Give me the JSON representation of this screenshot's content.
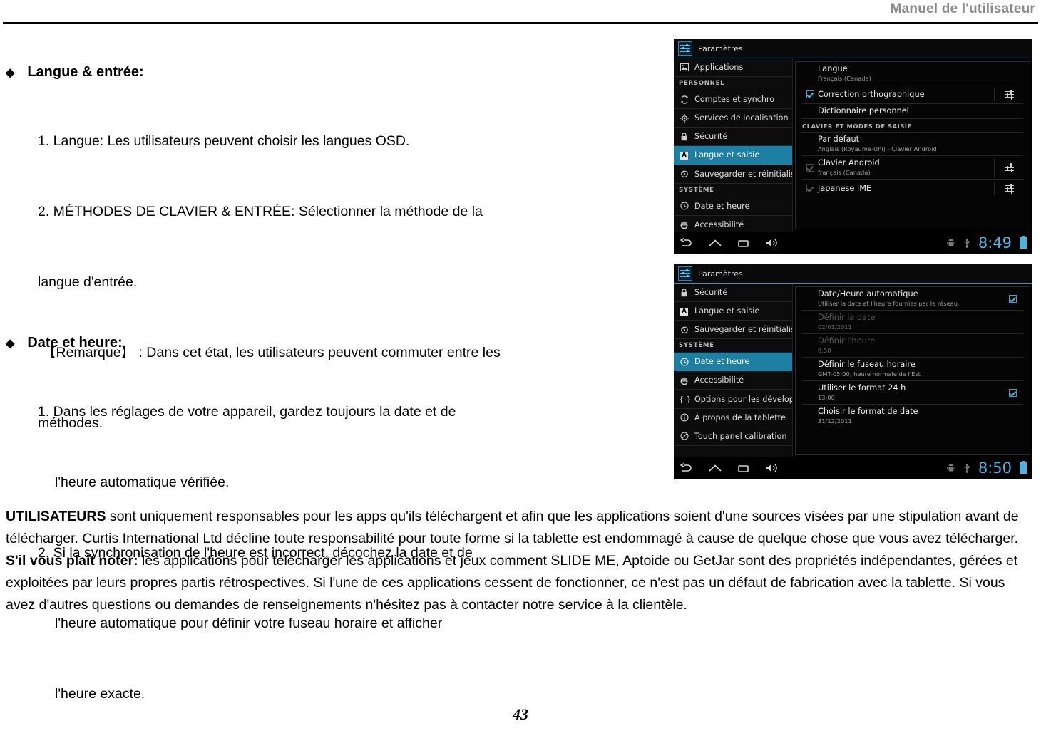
{
  "header": {
    "title": "Manuel de l'utilisateur"
  },
  "page_number": "43",
  "sections": [
    {
      "bullet": "◆",
      "heading": "Langue  & entrée:",
      "lines": [
        "1. Langue: Les utilisateurs peuvent choisir les langues OSD.",
        "2. MÉTHODES DE CLAVIER & ENTRÉE: Sélectionner la méthode de la",
        "langue d'entrée.",
        "【Remarque】 : Dans cet état, les utilisateurs peuvent commuter entre les",
        "méthodes."
      ]
    },
    {
      "bullet": "◆",
      "heading": "Date et heure:",
      "lines": [
        "1. Dans les réglages de votre appareil, gardez toujours la date et de",
        "l'heure automatique vérifiée.",
        "2. Si la synchronisation de l'heure est incorrect, décochez la date et de",
        "l'heure automatique pour définir votre fuseau horaire et afficher",
        "l'heure exacte."
      ]
    }
  ],
  "paragraphs": {
    "p1_bold": "UTILISATEURS",
    "p1_rest": " sont uniquement responsables pour les apps qu'ils téléchargent et afin que les applications soient d'une sources visées par une stipulation avant de télécharger. Curtis International Ltd décline toute responsabilité pour toute forme si la tablette est endommagé à cause de quelque chose que vous avez télécharger.",
    "p2_bold": "S'il vous plaît noter:",
    "p2_rest": " les applications pour télécharger les applications et jeux comment SLIDE ME, Aptoide ou GetJar sont des propriétés indépendantes, gérées et exploitées par leurs propres partis rétrospectives. Si l'une de ces applications cessent de fonctionner, ce n'est pas un défaut de fabrication avec la tablette. Si vous avez d'autres questions ou demandes de renseignements n'hésitez pas à contacter notre service à la clientèle."
  },
  "colors": {
    "accent_blue": "#1e7fa5",
    "clock_blue": "#4fb4dd",
    "header_gray": "#8a8a8a"
  },
  "screenshot_language": {
    "titlebar": "Paramètres",
    "sidebar": [
      {
        "type": "item",
        "icon": "image-icon",
        "label": "Applications",
        "selected": false
      },
      {
        "type": "group",
        "label": "PERSONNEL"
      },
      {
        "type": "item",
        "icon": "sync-icon",
        "label": "Comptes et synchro",
        "selected": false
      },
      {
        "type": "item",
        "icon": "location-icon",
        "label": "Services de localisation",
        "selected": false
      },
      {
        "type": "item",
        "icon": "lock-icon",
        "label": "Sécurité",
        "selected": false
      },
      {
        "type": "item",
        "icon": "letter-a-icon",
        "label": "Langue et saisie",
        "selected": true
      },
      {
        "type": "item",
        "icon": "backup-icon",
        "label": "Sauvegarder et réinitialiser",
        "selected": false
      },
      {
        "type": "group",
        "label": "SYSTÈME"
      },
      {
        "type": "item",
        "icon": "clock-icon",
        "label": "Date et heure",
        "selected": false
      },
      {
        "type": "item",
        "icon": "accessibility-icon",
        "label": "Accessibilité",
        "selected": false
      }
    ],
    "rows": [
      {
        "kind": "plain",
        "title": "Langue",
        "sub": "Français (Canada)",
        "checkbox": null,
        "settings_icon": false
      },
      {
        "kind": "check",
        "title": "Correction orthographique",
        "sub": "",
        "checkbox": "checked",
        "settings_icon": true
      },
      {
        "kind": "plain",
        "title": "Dictionnaire personnel",
        "sub": "",
        "checkbox": null,
        "settings_icon": false
      },
      {
        "kind": "group",
        "title": "CLAVIER ET MODES DE SAISIE"
      },
      {
        "kind": "plain",
        "title": "Par défaut",
        "sub": "Anglais (Royaume-Uni) - Clavier Android",
        "checkbox": null,
        "settings_icon": false
      },
      {
        "kind": "check",
        "title": "Clavier Android",
        "sub": "français (Canada)",
        "checkbox": "dim",
        "settings_icon": true
      },
      {
        "kind": "check",
        "title": "Japanese IME",
        "sub": "",
        "checkbox": "dim",
        "settings_icon": true
      }
    ],
    "statusbar": {
      "time": "8:49"
    }
  },
  "screenshot_datetime": {
    "titlebar": "Paramètres",
    "sidebar": [
      {
        "type": "item",
        "icon": "lock-icon",
        "label": "Sécurité",
        "selected": false
      },
      {
        "type": "item",
        "icon": "letter-a-icon",
        "label": "Langue et saisie",
        "selected": false
      },
      {
        "type": "item",
        "icon": "backup-icon",
        "label": "Sauvegarder et réinitialiser",
        "selected": false
      },
      {
        "type": "group",
        "label": "SYSTÈME"
      },
      {
        "type": "item",
        "icon": "clock-icon",
        "label": "Date et heure",
        "selected": true
      },
      {
        "type": "item",
        "icon": "accessibility-icon",
        "label": "Accessibilité",
        "selected": false
      },
      {
        "type": "item",
        "icon": "braces-icon",
        "label": "Options pour les développe",
        "selected": false
      },
      {
        "type": "item",
        "icon": "info-icon",
        "label": "À propos de la tablette",
        "selected": false
      },
      {
        "type": "item",
        "icon": "calibration-icon",
        "label": "Touch panel calibration",
        "selected": false
      }
    ],
    "rows": [
      {
        "title": "Date/Heure automatique",
        "sub": "Utiliser la date et l'heure fournies par le réseau",
        "dim": false,
        "checkbox": "checked"
      },
      {
        "title": "Définir la date",
        "sub": "02/01/2011",
        "dim": true,
        "checkbox": null
      },
      {
        "title": "Définir l'heure",
        "sub": "8:50",
        "dim": true,
        "checkbox": null
      },
      {
        "title": "Définir le fuseau horaire",
        "sub": "GMT-05:00, heure normale de l'Est",
        "dim": false,
        "checkbox": null
      },
      {
        "title": "Utiliser le format 24 h",
        "sub": "13:00",
        "dim": false,
        "checkbox": "checked"
      },
      {
        "title": "Choisir le format de date",
        "sub": "31/12/2011",
        "dim": false,
        "checkbox": null
      }
    ],
    "statusbar": {
      "time": "8:50"
    }
  }
}
